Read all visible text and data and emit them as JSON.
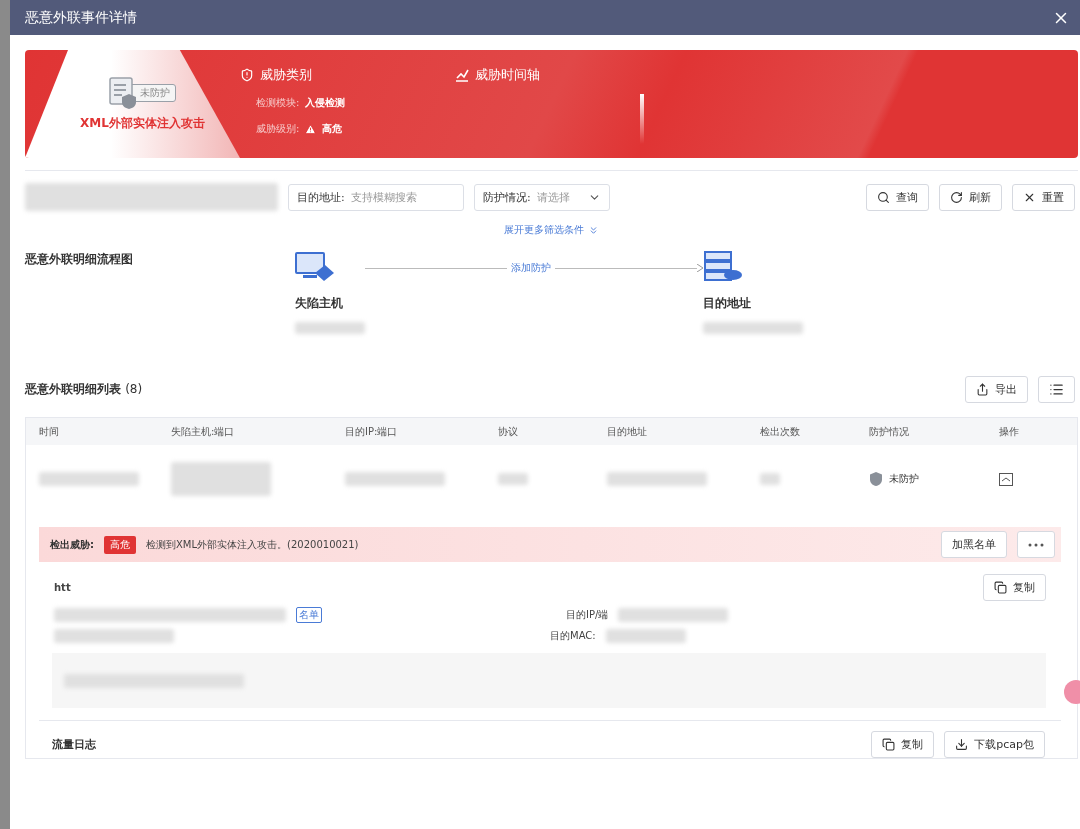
{
  "window": {
    "title": "恶意外联事件详情"
  },
  "banner": {
    "status_tag": "未防护",
    "name": "XML外部实体注入攻击",
    "category": {
      "title": "威胁类别",
      "fields": [
        {
          "label": "检测模块:",
          "value": "入侵检测",
          "kind": "text"
        },
        {
          "label": "威胁级别:",
          "value": "高危",
          "kind": "warning"
        }
      ]
    },
    "timeline": {
      "title": "威胁时间轴"
    }
  },
  "filters": [
    {
      "kind": "input",
      "label": "目的地址:",
      "placeholder": "支持模糊搜索"
    },
    {
      "kind": "select",
      "label": "防护情况:",
      "placeholder": "请选择"
    }
  ],
  "filter_buttons": [
    {
      "kind": "search",
      "label": "查询"
    },
    {
      "kind": "refresh",
      "label": "刷新"
    },
    {
      "kind": "reset",
      "label": "重置"
    }
  ],
  "expand_link": "展开更多筛选条件",
  "flow": {
    "title": "恶意外联明细流程图",
    "source": "失陷主机",
    "action": "添加防护",
    "target": "目的地址"
  },
  "list": {
    "title": "恶意外联明细列表",
    "count": "(8)",
    "export": "导出",
    "columns": [
      "时间",
      "失陷主机:端口",
      "目的IP:端口",
      "协议",
      "目的地址",
      "检出次数",
      "防护情况",
      "操作"
    ],
    "row": {
      "protection": "未防护",
      "expanded": true
    }
  },
  "threat": {
    "label": "检出威胁:",
    "level": "高危",
    "message": "检测到XML外部实体注入攻击。(2020010021)",
    "blacklist": "加黑名单"
  },
  "detail": {
    "protocol": "htt",
    "copy": "复制",
    "link": "名单",
    "fields": [
      "目的IP/端",
      "目的MAC:"
    ]
  },
  "traffic_log": {
    "title": "流量日志",
    "copy": "复制",
    "download": "下载pcap包"
  }
}
